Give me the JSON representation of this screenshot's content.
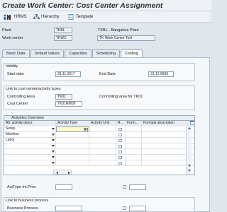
{
  "title": "Create Work Center: Cost Center Assignment",
  "toolbar": {
    "hrms_label": "HRMS",
    "hierarchy_label": "Hierarchy",
    "template_label": "Template"
  },
  "header": {
    "plant_label": "Plant",
    "plant_value": "TKBL",
    "plant_desc": "TKBL - Bangalore Plant",
    "workcenter_label": "Work center",
    "workcenter_value": "TKWC",
    "workcenter_desc": "TK Work Center Tool"
  },
  "tabs": [
    "Basic Data",
    "Default Values",
    "Capacities",
    "Scheduling",
    "Costing"
  ],
  "active_tab": "Costing",
  "validity": {
    "title": "Validity",
    "start_label": "Start date",
    "start_value": "28.11.2017",
    "end_label": "End Date",
    "end_value": "31.12.9999"
  },
  "link_cc": {
    "title": "Link to cost center/activity types",
    "ca_label": "Controlling Area",
    "ca_value": "TK01",
    "ca_desc": "Controlling area for TK01",
    "cc_label": "Cost Center",
    "cc_value": "TK01RM09"
  },
  "activities": {
    "title": "Activities Overview",
    "columns": [
      "Alt. activity descr.",
      "Activity Type",
      "Activity Unit",
      "R...",
      "Form...",
      "Formula description"
    ],
    "rows": [
      {
        "descr": "Setup"
      },
      {
        "descr": "Machine"
      },
      {
        "descr": "Labor"
      },
      {
        "descr": ""
      },
      {
        "descr": ""
      },
      {
        "descr": ""
      }
    ]
  },
  "acttype_label": "ActType Int.Proc.",
  "business": {
    "title": "Link to business process",
    "bp_label": "Business Process"
  },
  "colors": {
    "background": "#dfe6ec",
    "highlight_field": "#fff8c8",
    "icon_blue": "#2f6fb0"
  }
}
